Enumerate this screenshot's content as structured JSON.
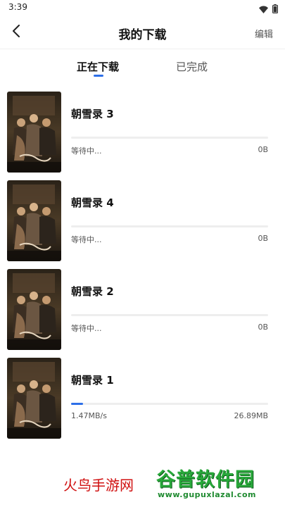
{
  "status_bar": {
    "time": "3:39"
  },
  "header": {
    "title": "我的下载",
    "edit_label": "编辑"
  },
  "tabs": [
    {
      "label": "正在下载",
      "active": true
    },
    {
      "label": "已完成",
      "active": false
    }
  ],
  "downloads": [
    {
      "title": "朝雪录 3",
      "status": "等待中...",
      "size": "0B",
      "progress": 0
    },
    {
      "title": "朝雪录 4",
      "status": "等待中...",
      "size": "0B",
      "progress": 0
    },
    {
      "title": "朝雪录 2",
      "status": "等待中...",
      "size": "0B",
      "progress": 0
    },
    {
      "title": "朝雪录 1",
      "status": "1.47MB/s",
      "size": "26.89MB",
      "progress": 0.06
    }
  ],
  "watermark": {
    "site_name": "火鸟手游网",
    "logo_text": "谷普软件园",
    "logo_url": "www.gupuxlazal.com"
  },
  "colors": {
    "accent": "#2d6fe8",
    "watermark_red": "#d01010",
    "watermark_green": "#28a83a"
  },
  "icons": {
    "back": "chevron-left-icon",
    "wifi": "wifi-icon",
    "battery": "battery-icon"
  }
}
